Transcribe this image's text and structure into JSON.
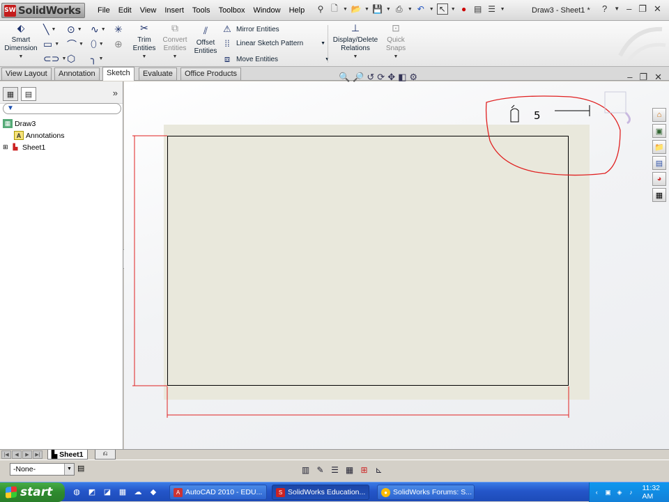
{
  "app": {
    "logo_badge": "SW",
    "logo_text": "SolidWorks"
  },
  "menu": [
    "File",
    "Edit",
    "View",
    "Insert",
    "Tools",
    "Toolbox",
    "Window",
    "Help"
  ],
  "document_title": "Draw3 - Sheet1 *",
  "command_manager": {
    "smart_dimension": "Smart Dimension",
    "trim_entities": "Trim Entities",
    "convert_entities": "Convert Entities",
    "offset_entities": "Offset Entities",
    "mirror_entities": "Mirror Entities",
    "linear_sketch_pattern": "Linear Sketch Pattern",
    "move_entities": "Move Entities",
    "display_delete_relations": "Display/Delete Relations",
    "quick_snaps": "Quick Snaps"
  },
  "tabs": [
    "View Layout",
    "Annotation",
    "Sketch",
    "Evaluate",
    "Office Products"
  ],
  "active_tab": "Sketch",
  "feature_tree": {
    "root": "Draw3",
    "annotations": "Annotations",
    "sheet": "Sheet1"
  },
  "sketch": {
    "annotation_text": "5",
    "border_color": "#e02020"
  },
  "sheet_tab": "Sheet1",
  "layer_select": "-None-",
  "taskbar": {
    "start": "start",
    "buttons": [
      "AutoCAD 2010 - EDU...",
      "SolidWorks Education...",
      "SolidWorks Forums: S..."
    ],
    "clock": "11:32 AM"
  }
}
